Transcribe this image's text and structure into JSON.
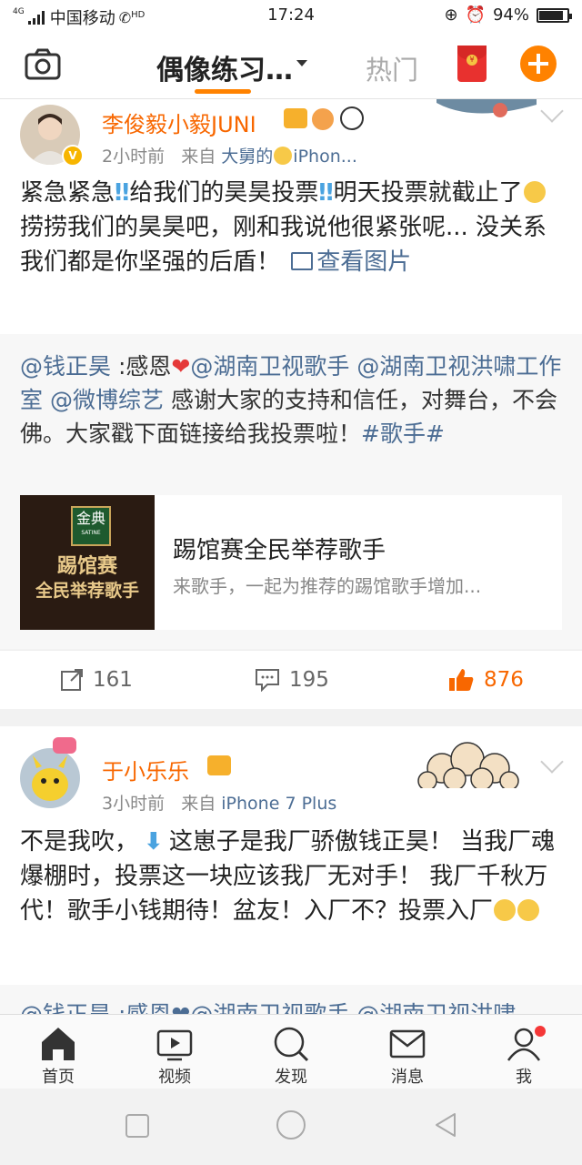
{
  "status_bar": {
    "network": "4G",
    "carrier": "中国移动",
    "hd": "HD",
    "time": "17:24",
    "battery": "94%",
    "battery_level": 0.94
  },
  "nav": {
    "camera_icon": "camera-icon",
    "title": "偶像练习…",
    "hot_tab": "热门",
    "redpacket_icon": "red-packet-icon",
    "compose_icon": "plus-icon",
    "accent": "#ff8200"
  },
  "posts": [
    {
      "username": "李俊毅小毅JUNI",
      "time": "2小时前",
      "from": "来自",
      "source": "大舅的",
      "source2": "iPhon...",
      "text_a": "紧急紧急",
      "text_b": "给我们的昊昊投票",
      "text_c": "明天投票就截止了",
      "text_d": "捞捞我们的昊昊吧，刚和我说他很紧张呢... 没关系 我们都是你坚强的后盾！",
      "view_image": "查看图片",
      "repost": {
        "mention": "@钱正昊",
        "text1": ":感恩",
        "mention2": "@湖南卫视歌手",
        "mention3": "@湖南卫视洪啸工作室",
        "mention4": "@微博综艺",
        "text2": "感谢大家的支持和信任，对舞台，不会佛。大家戳下面链接给我投票啦！",
        "hashtag": "#歌手#",
        "card_title": "踢馆赛全民举荐歌手",
        "card_sub": "来歌手，一起为推荐的踢馆歌手增加...",
        "card_img_brand": "金典",
        "card_img_brand_sub": "SATINE",
        "card_img_line1": "踢馆赛",
        "card_img_line2": "全民举荐歌手"
      },
      "reposts": "161",
      "comments": "195",
      "likes": "876"
    },
    {
      "username": "于小乐乐",
      "time": "3小时前",
      "from": "来自",
      "source": "iPhone 7 Plus",
      "text_a": "不是我吹，",
      "text_b": "这崽子是我厂骄傲钱正昊！ 当我厂魂爆棚时，投票这一块应该我厂无对手！ 我厂千秋万代！歌手小钱期待！盆友！入厂不？投票入厂",
      "repost_peek": "@钱正昊 :感恩❤@湖南卫视歌手 @湖南卫视洪啸"
    }
  ],
  "tabs": [
    {
      "label": "首页",
      "icon": "home-icon"
    },
    {
      "label": "视频",
      "icon": "video-icon"
    },
    {
      "label": "发现",
      "icon": "discover-icon"
    },
    {
      "label": "消息",
      "icon": "message-icon"
    },
    {
      "label": "我",
      "icon": "profile-icon"
    }
  ]
}
